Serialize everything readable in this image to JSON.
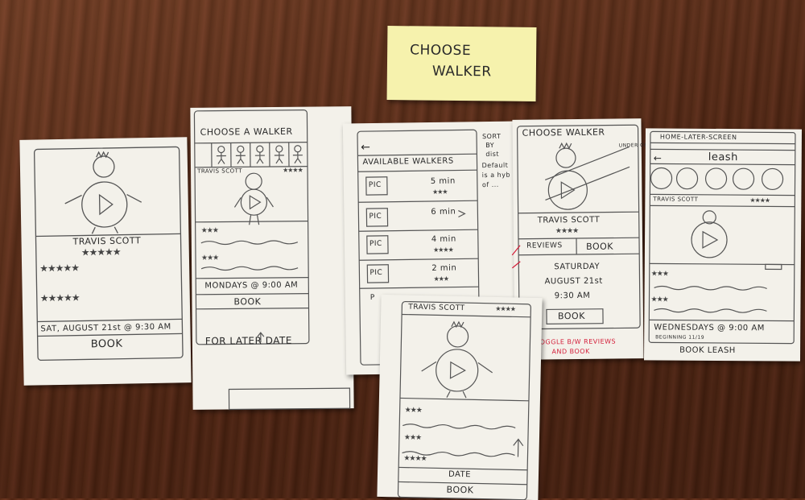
{
  "sticky_note": {
    "line1": "CHOOSE",
    "line2": "WALKER"
  },
  "sheet1": {
    "name": "TRAVIS SCOTT",
    "rating": "★★★★★",
    "review1": "★★★★★",
    "review2": "★★★★★",
    "date": "SAT, AUGUST 21st @ 9:30 AM",
    "book": "BOOK"
  },
  "sheet2": {
    "title": "CHOOSE A WALKER",
    "name_tag": "TRAVIS SCOTT",
    "name_stars": "★★★★",
    "review1": "★★★",
    "review2": "★★★",
    "schedule": "MONDAYS @ 9:00 AM",
    "book": "BOOK",
    "note": "FOR LATER DATE"
  },
  "sheet3": {
    "back": "←",
    "title": "AVAILABLE WALKERS",
    "walkers": [
      {
        "pic": "PIC",
        "time": "5 min",
        "stars": "★★★"
      },
      {
        "pic": "PIC",
        "time": "6 min",
        "stars": ""
      },
      {
        "pic": "PIC",
        "time": "4 min",
        "stars": "★★★★"
      },
      {
        "pic": "PIC",
        "time": "2 min",
        "stars": "★★★"
      }
    ],
    "last_pic": "P",
    "side_note": [
      "SORT",
      "BY",
      "dist",
      "Default",
      "is a hyb",
      "of ..."
    ]
  },
  "sheet4": {
    "title": "CHOOSE WALKER",
    "side": "UNDER OFFER",
    "name": "TRAVIS SCOTT",
    "stars": "★★★★",
    "tab_reviews": "REVIEWS",
    "tab_book": "BOOK",
    "day": "SATURDAY",
    "date": "AUGUST 21st",
    "time": "9:30 AM",
    "book": "BOOK",
    "note_line1": "TOGGLE B/W REVIEWS",
    "note_line2": "AND BOOK"
  },
  "sheet5": {
    "header": "HOME-LATER-SCREEN",
    "back": "←",
    "title": "leash",
    "name": "TRAVIS SCOTT",
    "stars": "★★★★",
    "review1": "★★★",
    "review2": "★★★",
    "schedule": "WEDNESDAYS @ 9:00 AM",
    "schedule_sub": "BEGINNING 11/19",
    "book": "BOOK LEASH"
  },
  "sheet6": {
    "name": "TRAVIS SCOTT",
    "stars": "★★★★",
    "review1": "★★★",
    "review2": "★★★",
    "review3": "★★★★",
    "date_label": "DATE",
    "book": "BOOK"
  }
}
